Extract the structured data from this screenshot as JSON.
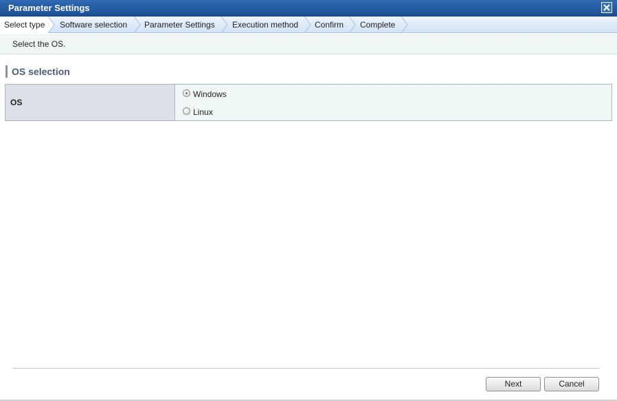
{
  "window": {
    "title": "Parameter Settings",
    "close_icon": "close-icon"
  },
  "steps": [
    {
      "label": "Select type",
      "active": true
    },
    {
      "label": "Software selection",
      "active": false
    },
    {
      "label": "Parameter Settings",
      "active": false
    },
    {
      "label": "Execution method",
      "active": false
    },
    {
      "label": "Confirm",
      "active": false
    },
    {
      "label": "Complete",
      "active": false
    }
  ],
  "instruction": "Select the OS.",
  "section": {
    "title": "OS selection"
  },
  "os_field": {
    "label": "OS",
    "options": [
      {
        "label": "Windows",
        "selected": true
      },
      {
        "label": "Linux",
        "selected": false
      }
    ]
  },
  "buttons": {
    "next": "Next",
    "cancel": "Cancel"
  },
  "colors": {
    "titlebar": "#1c4f93",
    "stepbar": "#d3e2f5",
    "instruction_bg": "#edf5f5",
    "label_cell_bg": "#dde0e7",
    "section_title": "#4b5a78"
  }
}
